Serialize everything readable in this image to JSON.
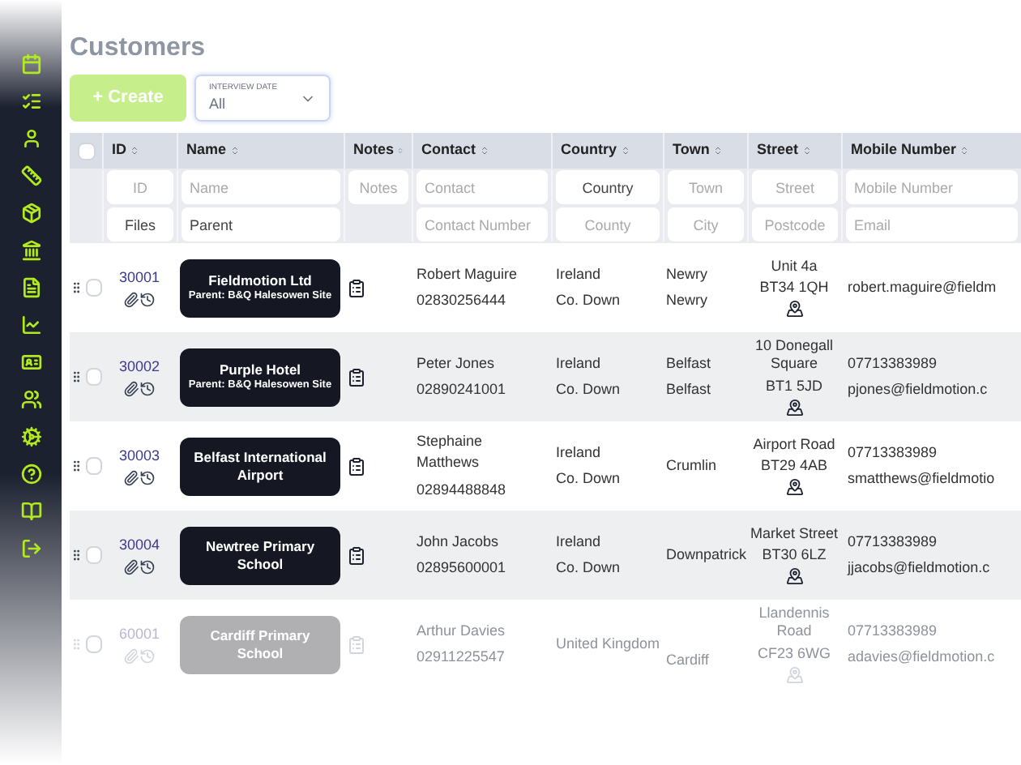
{
  "page": {
    "title": "Customers"
  },
  "toolbar": {
    "create_button": "+ Create",
    "filter": {
      "label": "INTERVIEW DATE",
      "value": "All"
    }
  },
  "table": {
    "select_all": {
      "checked": false
    },
    "columns": [
      "ID",
      "Name",
      "Notes",
      "Contact",
      "Country",
      "Town",
      "Street",
      "Mobile Number"
    ],
    "filters": [
      [
        {
          "placeholder": "ID"
        },
        {
          "value": "Files"
        }
      ],
      [
        {
          "placeholder": "Name"
        },
        {
          "value": "Parent"
        }
      ],
      [
        {
          "placeholder": "Notes"
        }
      ],
      [
        {
          "placeholder": "Contact"
        },
        {
          "placeholder": "Contact Number"
        }
      ],
      [
        {
          "value": "Country"
        },
        {
          "placeholder": "County"
        }
      ],
      [
        {
          "placeholder": "Town"
        },
        {
          "placeholder": "City"
        }
      ],
      [
        {
          "placeholder": "Street"
        },
        {
          "placeholder": "Postcode"
        }
      ],
      [
        {
          "placeholder": "Mobile Number"
        },
        {
          "placeholder": "Email"
        }
      ]
    ],
    "rows": [
      {
        "checked": false,
        "dimmed": false,
        "id": "30001",
        "name": "Fieldmotion Ltd",
        "parent": "Parent: B&Q Halesowen Site",
        "contact": "Robert Maguire",
        "phone": "02830256444",
        "country": "Ireland",
        "county": "Co. Down",
        "town": "Newry",
        "city": "Newry",
        "street": [
          "Unit 4a",
          "BT34 1QH"
        ],
        "email": "robert.maguire@fieldm"
      },
      {
        "checked": false,
        "dimmed": false,
        "id": "30002",
        "name": "Purple Hotel",
        "parent": "Parent: B&Q Halesowen Site",
        "contact": "Peter Jones",
        "phone": "02890241001",
        "country": "Ireland",
        "county": "Co. Down",
        "town": "Belfast",
        "city": "Belfast",
        "street": [
          "10 Donegall Square",
          "BT1 5JD"
        ],
        "mobile": "07713383989",
        "email": "pjones@fieldmotion.c"
      },
      {
        "checked": false,
        "dimmed": false,
        "id": "30003",
        "name": "Belfast International Airport",
        "contact": "Stephaine Matthews",
        "phone": "02894488848",
        "country": "Ireland",
        "county": "Co. Down",
        "town": "Crumlin",
        "street": [
          "Airport Road",
          "BT29 4AB"
        ],
        "mobile": "07713383989",
        "email": "smatthews@fieldmotio"
      },
      {
        "checked": false,
        "dimmed": false,
        "id": "30004",
        "name": "Newtree Primary School",
        "contact": "John Jacobs",
        "phone": "02895600001",
        "country": "Ireland",
        "county": "Co. Down",
        "town": "Downpatrick",
        "street": [
          "Market Street",
          "BT30 6LZ"
        ],
        "mobile": "07713383989",
        "email": "jjacobs@fieldmotion.c"
      },
      {
        "checked": false,
        "dimmed": true,
        "id": "60001",
        "name": "Cardiff Primary School",
        "contact": "Arthur Davies",
        "phone": "02911225547",
        "country": "United Kingdom",
        "city": "Cardiff",
        "street": [
          "Llandennis Road",
          "CF23 6WG"
        ],
        "mobile": "07713383989",
        "email": "adavies@fieldmotion.c"
      }
    ]
  }
}
